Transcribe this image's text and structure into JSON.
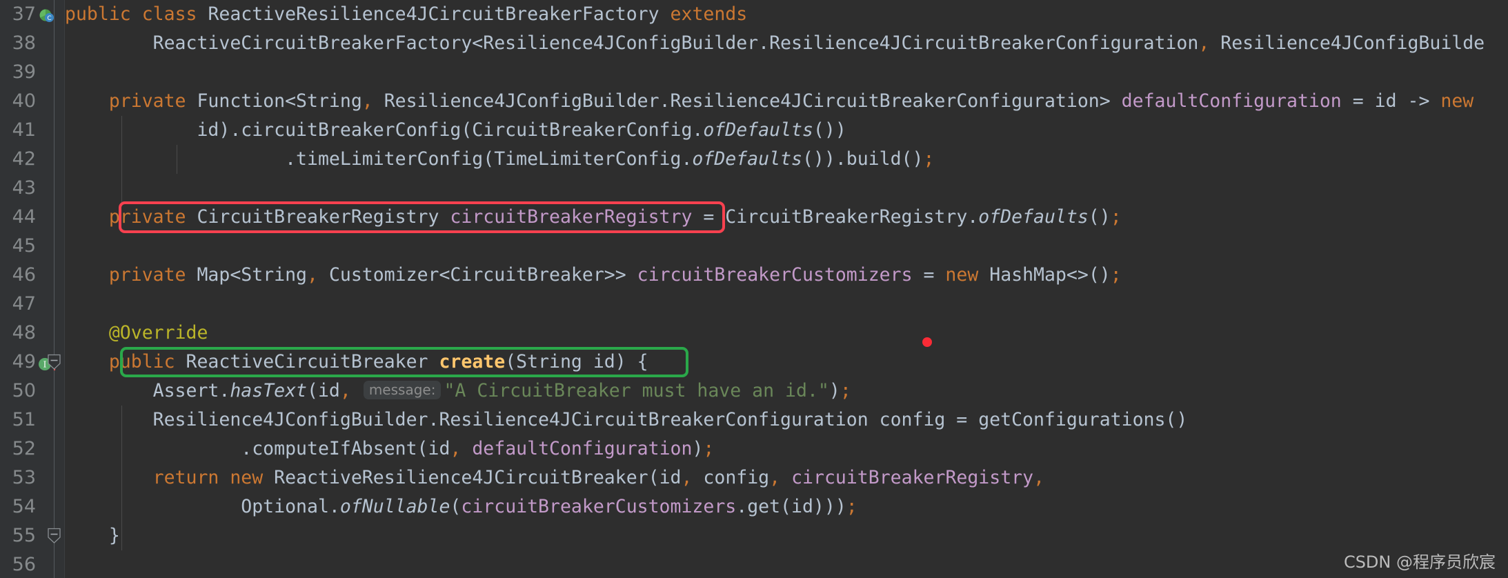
{
  "app": {
    "theme": "darcula",
    "language": "Java",
    "background": "#2e2e2e",
    "gutter_background": "#313335",
    "default_text_color": "#a9b7c6"
  },
  "colors": {
    "keyword": "#cc7832",
    "field": "#c39ac9",
    "string": "#6a8759",
    "annotation": "#bbb529",
    "method": "#ffc66d",
    "identifier": "#b6c3d1",
    "line_number": "#868a8c",
    "hint_background": "#3c3f41",
    "hint_text": "#8c8c8c",
    "highlight_red": "#f8414f",
    "highlight_green": "#2aa84a",
    "marker_dot_red": "#fa2b36"
  },
  "gutter": {
    "line_numbers": [
      37,
      38,
      39,
      40,
      41,
      42,
      43,
      44,
      45,
      46,
      47,
      48,
      49,
      50,
      51,
      52,
      53,
      54,
      55,
      56
    ],
    "icons": [
      {
        "line": 37,
        "name": "class-marker-icon",
        "tooltip": "Class"
      },
      {
        "line": 49,
        "name": "implementing-method-icon",
        "tooltip": "Implements method"
      },
      {
        "line": 49,
        "name": "overriding-arrow-icon",
        "tooltip": "Overrides method in superclass"
      }
    ],
    "fold_handles": [
      {
        "line": 49,
        "state": "expanded"
      },
      {
        "line": 55,
        "state": "expanded"
      }
    ]
  },
  "code": {
    "first_visible_line": 37,
    "lines": [
      {
        "n": 37,
        "tokens": [
          {
            "t": "public",
            "c": "kw"
          },
          {
            "t": " ",
            "c": "plain"
          },
          {
            "t": "class",
            "c": "kw"
          },
          {
            "t": " ReactiveResilience4JCircuitBreakerFactory ",
            "c": "plain"
          },
          {
            "t": "extends",
            "c": "kw"
          }
        ]
      },
      {
        "n": 38,
        "tokens": [
          {
            "t": "        ReactiveCircuitBreakerFactory<Resilience4JConfigBuilder.Resilience4JCircuitBreakerConfiguration",
            "c": "plain"
          },
          {
            "t": ",",
            "c": "punc"
          },
          {
            "t": " Resilience4JConfigBuilde",
            "c": "plain"
          }
        ]
      },
      {
        "n": 39,
        "tokens": []
      },
      {
        "n": 40,
        "tokens": [
          {
            "t": "    ",
            "c": "plain"
          },
          {
            "t": "private",
            "c": "kw"
          },
          {
            "t": " Function<String",
            "c": "plain"
          },
          {
            "t": ",",
            "c": "punc"
          },
          {
            "t": " Resilience4JConfigBuilder.Resilience4JCircuitBreakerConfiguration> ",
            "c": "plain"
          },
          {
            "t": "defaultConfiguration",
            "c": "fld"
          },
          {
            "t": " = id -> ",
            "c": "plain"
          },
          {
            "t": "new",
            "c": "kw"
          }
        ]
      },
      {
        "n": 41,
        "tokens": [
          {
            "t": "            id).circuitBreakerConfig(CircuitBreakerConfig.",
            "c": "plain"
          },
          {
            "t": "ofDefaults",
            "c": "stat"
          },
          {
            "t": "())",
            "c": "plain"
          }
        ]
      },
      {
        "n": 42,
        "tokens": [
          {
            "t": "                    .timeLimiterConfig(TimeLimiterConfig.",
            "c": "plain"
          },
          {
            "t": "ofDefaults",
            "c": "stat"
          },
          {
            "t": "()).build()",
            "c": "plain"
          },
          {
            "t": ";",
            "c": "punc"
          }
        ]
      },
      {
        "n": 43,
        "tokens": []
      },
      {
        "n": 44,
        "tokens": [
          {
            "t": "    ",
            "c": "plain"
          },
          {
            "t": "private",
            "c": "kw"
          },
          {
            "t": " CircuitBreakerRegistry ",
            "c": "plain"
          },
          {
            "t": "circuitBreakerRegistry",
            "c": "fld"
          },
          {
            "t": " = CircuitBreakerRegistry.",
            "c": "plain"
          },
          {
            "t": "ofDefaults",
            "c": "stat"
          },
          {
            "t": "()",
            "c": "plain"
          },
          {
            "t": ";",
            "c": "punc"
          }
        ]
      },
      {
        "n": 45,
        "tokens": []
      },
      {
        "n": 46,
        "tokens": [
          {
            "t": "    ",
            "c": "plain"
          },
          {
            "t": "private",
            "c": "kw"
          },
          {
            "t": " Map<String",
            "c": "plain"
          },
          {
            "t": ",",
            "c": "punc"
          },
          {
            "t": " Customizer<CircuitBreaker>> ",
            "c": "plain"
          },
          {
            "t": "circuitBreakerCustomizers",
            "c": "fld"
          },
          {
            "t": " = ",
            "c": "plain"
          },
          {
            "t": "new",
            "c": "kw"
          },
          {
            "t": " HashMap<>()",
            "c": "plain"
          },
          {
            "t": ";",
            "c": "punc"
          }
        ]
      },
      {
        "n": 47,
        "tokens": []
      },
      {
        "n": 48,
        "tokens": [
          {
            "t": "    ",
            "c": "plain"
          },
          {
            "t": "@Override",
            "c": "anno"
          }
        ]
      },
      {
        "n": 49,
        "tokens": [
          {
            "t": "    ",
            "c": "plain"
          },
          {
            "t": "public",
            "c": "kw"
          },
          {
            "t": " ReactiveCircuitBreaker ",
            "c": "plain"
          },
          {
            "t": "create",
            "c": "meth"
          },
          {
            "t": "(String id) {",
            "c": "plain"
          }
        ]
      },
      {
        "n": 50,
        "tokens": [
          {
            "t": "        Assert.",
            "c": "plain"
          },
          {
            "t": "hasText",
            "c": "stat"
          },
          {
            "t": "(id",
            "c": "plain"
          },
          {
            "t": ",",
            "c": "punc"
          },
          {
            "t": " ",
            "c": "plain"
          },
          {
            "t": "message:",
            "c": "hintpill"
          },
          {
            "t": "\"A CircuitBreaker must have an id.\"",
            "c": "str"
          },
          {
            "t": ")",
            "c": "plain"
          },
          {
            "t": ";",
            "c": "punc"
          }
        ]
      },
      {
        "n": 51,
        "tokens": [
          {
            "t": "        Resilience4JConfigBuilder.Resilience4JCircuitBreakerConfiguration config = getConfigurations()",
            "c": "plain"
          }
        ]
      },
      {
        "n": 52,
        "tokens": [
          {
            "t": "                .computeIfAbsent(id",
            "c": "plain"
          },
          {
            "t": ",",
            "c": "punc"
          },
          {
            "t": " ",
            "c": "plain"
          },
          {
            "t": "defaultConfiguration",
            "c": "fld"
          },
          {
            "t": ")",
            "c": "plain"
          },
          {
            "t": ";",
            "c": "punc"
          }
        ]
      },
      {
        "n": 53,
        "tokens": [
          {
            "t": "        ",
            "c": "plain"
          },
          {
            "t": "return",
            "c": "kw"
          },
          {
            "t": " ",
            "c": "plain"
          },
          {
            "t": "new",
            "c": "kw"
          },
          {
            "t": " ReactiveResilience4JCircuitBreaker(id",
            "c": "plain"
          },
          {
            "t": ",",
            "c": "punc"
          },
          {
            "t": " config",
            "c": "plain"
          },
          {
            "t": ",",
            "c": "punc"
          },
          {
            "t": " ",
            "c": "plain"
          },
          {
            "t": "circuitBreakerRegistry",
            "c": "fld"
          },
          {
            "t": ",",
            "c": "punc"
          }
        ]
      },
      {
        "n": 54,
        "tokens": [
          {
            "t": "                Optional.",
            "c": "plain"
          },
          {
            "t": "ofNullable",
            "c": "stat"
          },
          {
            "t": "(",
            "c": "plain"
          },
          {
            "t": "circuitBreakerCustomizers",
            "c": "fld"
          },
          {
            "t": ".get(id)))",
            "c": "plain"
          },
          {
            "t": ";",
            "c": "punc"
          }
        ]
      },
      {
        "n": 55,
        "tokens": [
          {
            "t": "    }",
            "c": "plain"
          }
        ]
      },
      {
        "n": 56,
        "tokens": []
      }
    ]
  },
  "annotations": {
    "boxes": [
      {
        "name": "highlight-box-field-declaration",
        "color": "red",
        "line": 44,
        "label": "private CircuitBreakerRegistry circuitBreakerRegistry"
      },
      {
        "name": "highlight-box-create-method",
        "color": "green",
        "line": 49,
        "label": "public ReactiveCircuitBreaker create(String id) {"
      }
    ],
    "dot": {
      "name": "caret-dot-marker",
      "line": 49,
      "color": "#fa2b36"
    }
  },
  "watermark": {
    "text": "CSDN @程序员欣宸"
  }
}
